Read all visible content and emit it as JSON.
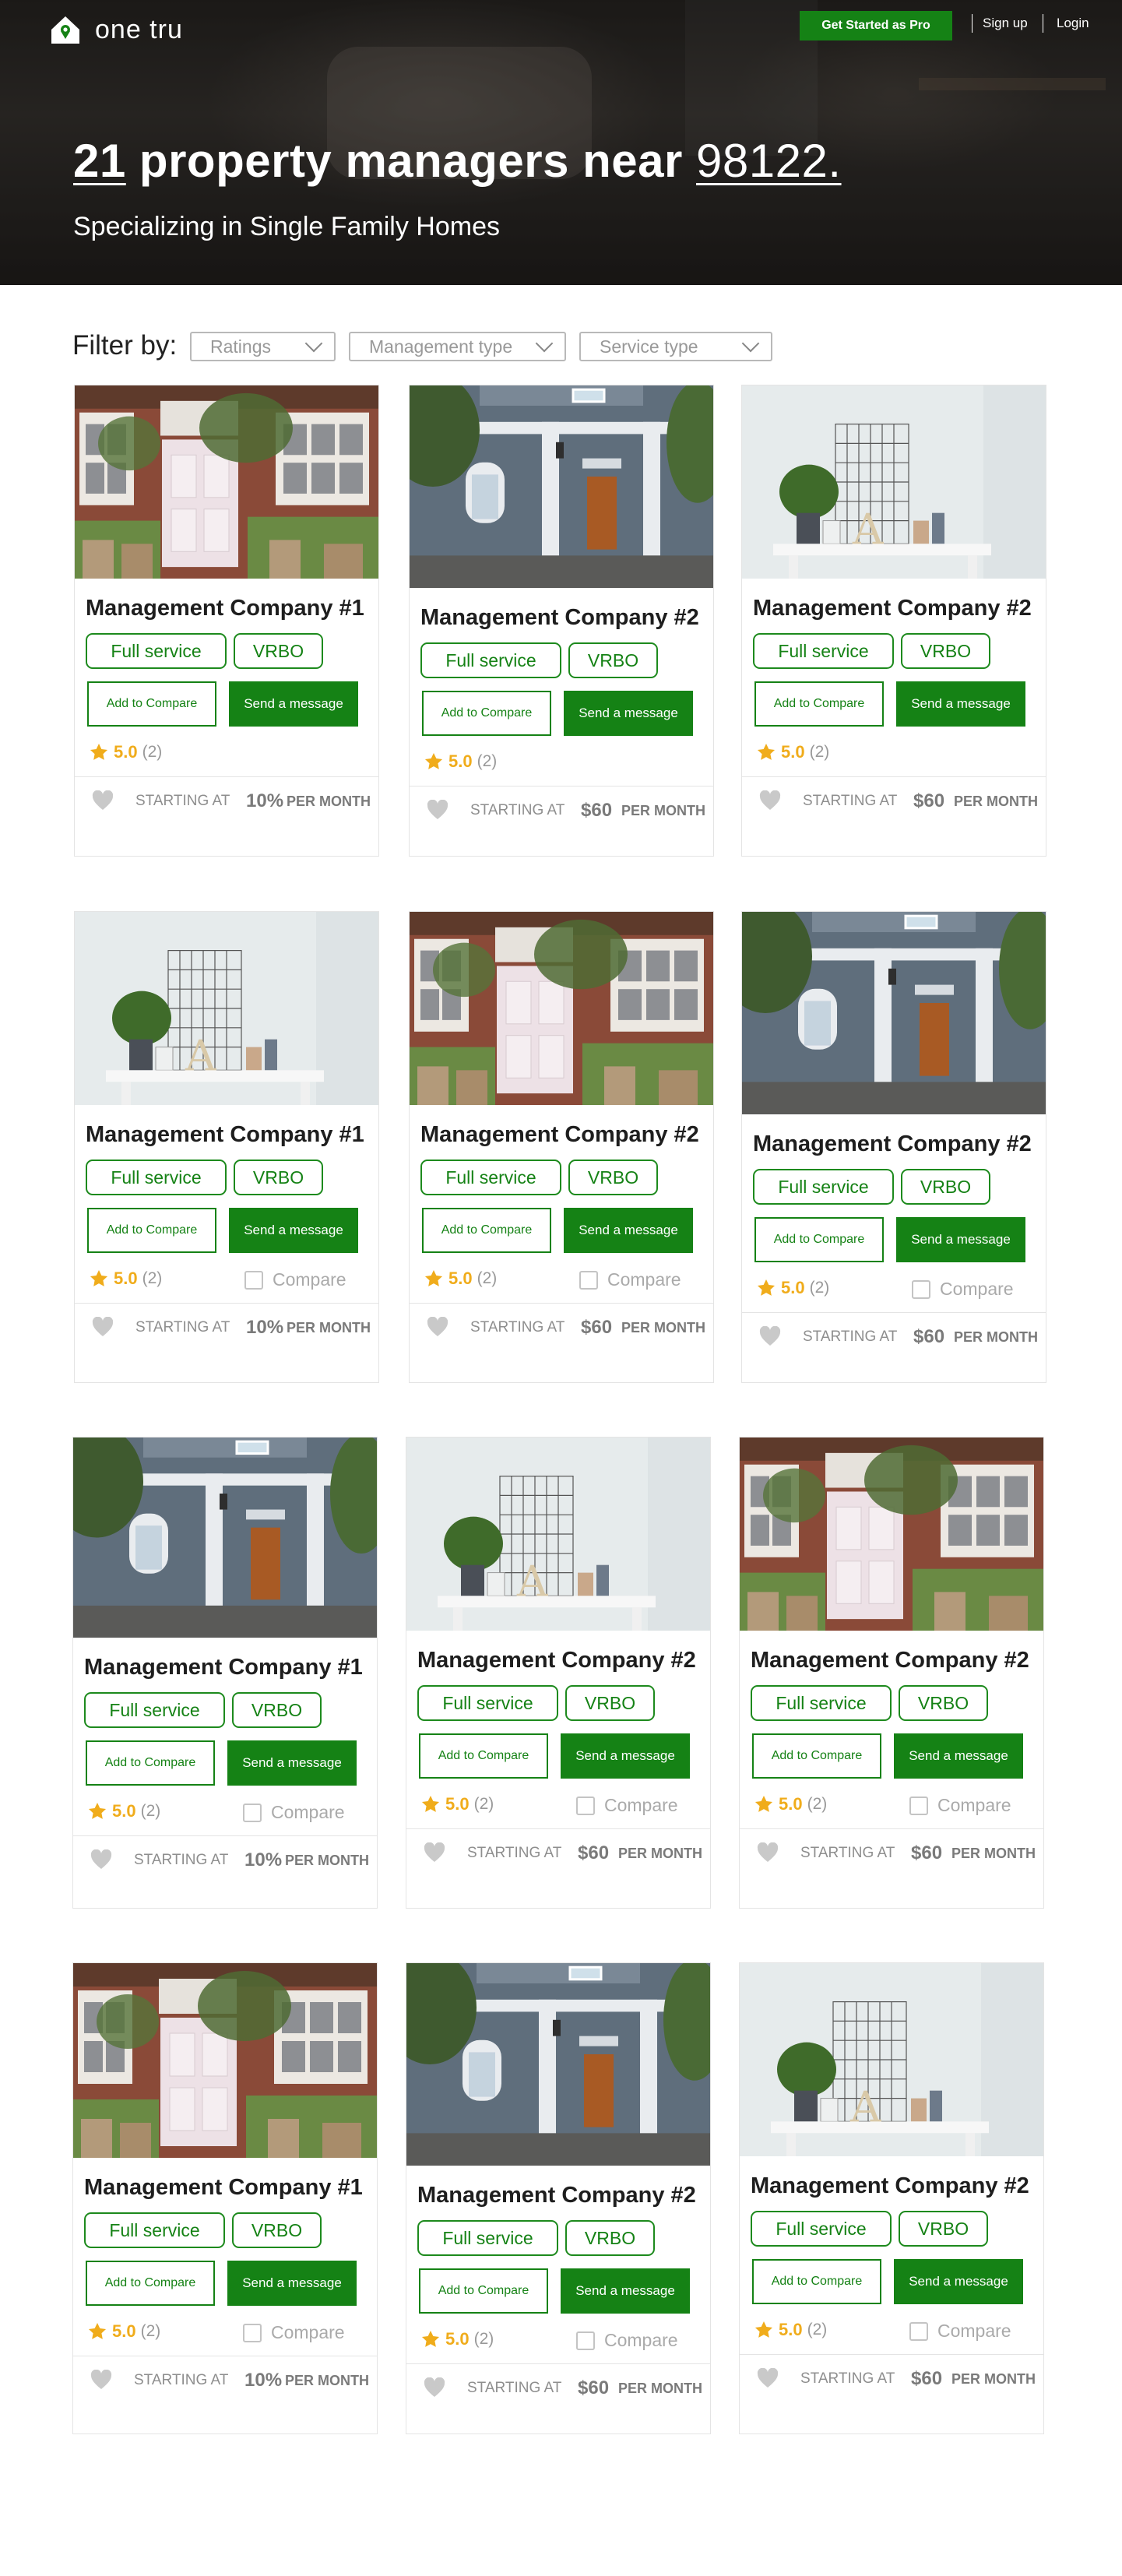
{
  "brand": {
    "name": "one tru",
    "accent": "#158215",
    "star": "#f0ac1b"
  },
  "nav": {
    "pro_button": "Get Started as Pro",
    "signup": "Sign up",
    "login": "Login"
  },
  "hero": {
    "count": "21",
    "mid_text": " property managers near ",
    "zip": "98122.",
    "subtitle": "Specializing in Single Family Homes"
  },
  "filters": {
    "label": "Filter by:",
    "items": [
      "Ratings",
      "Management type",
      "Service type"
    ]
  },
  "labels": {
    "add_compare": "Add to Compare",
    "send_message": "Send a message",
    "compare": "Compare",
    "starting_at": "STARTING AT",
    "per_month": "PER MONTH"
  },
  "cards": [
    {
      "image": "brick-door-image",
      "title": "Management Company #1",
      "tags": [
        "Full service",
        "VRBO"
      ],
      "rating": "5.0",
      "reviews": "(2)",
      "price": "10%",
      "has_compare": false
    },
    {
      "image": "blue-house-image",
      "title": "Management Company #2",
      "tags": [
        "Full service",
        "VRBO"
      ],
      "rating": "5.0",
      "reviews": "(2)",
      "price": "$60",
      "has_compare": false
    },
    {
      "image": "plant-shelf-image",
      "title": "Management Company #2",
      "tags": [
        "Full service",
        "VRBO"
      ],
      "rating": "5.0",
      "reviews": "(2)",
      "price": "$60",
      "has_compare": false
    },
    {
      "image": "plant-shelf-image",
      "title": "Management Company #1",
      "tags": [
        "Full service",
        "VRBO"
      ],
      "rating": "5.0",
      "reviews": "(2)",
      "price": "10%",
      "has_compare": true
    },
    {
      "image": "brick-door-image",
      "title": "Management Company #2",
      "tags": [
        "Full service",
        "VRBO"
      ],
      "rating": "5.0",
      "reviews": "(2)",
      "price": "$60",
      "has_compare": true
    },
    {
      "image": "blue-house-image",
      "title": "Management Company #2",
      "tags": [
        "Full service",
        "VRBO"
      ],
      "rating": "5.0",
      "reviews": "(2)",
      "price": "$60",
      "has_compare": true
    },
    {
      "image": "blue-house-image",
      "title": "Management Company #1",
      "tags": [
        "Full service",
        "VRBO"
      ],
      "rating": "5.0",
      "reviews": "(2)",
      "price": "10%",
      "has_compare": true
    },
    {
      "image": "plant-shelf-image",
      "title": "Management Company #2",
      "tags": [
        "Full service",
        "VRBO"
      ],
      "rating": "5.0",
      "reviews": "(2)",
      "price": "$60",
      "has_compare": true
    },
    {
      "image": "brick-door-image",
      "title": "Management Company #2",
      "tags": [
        "Full service",
        "VRBO"
      ],
      "rating": "5.0",
      "reviews": "(2)",
      "price": "$60",
      "has_compare": true
    },
    {
      "image": "brick-door-image",
      "title": "Management Company #1",
      "tags": [
        "Full service",
        "VRBO"
      ],
      "rating": "5.0",
      "reviews": "(2)",
      "price": "10%",
      "has_compare": true
    },
    {
      "image": "blue-house-image",
      "title": "Management Company #2",
      "tags": [
        "Full service",
        "VRBO"
      ],
      "rating": "5.0",
      "reviews": "(2)",
      "price": "$60",
      "has_compare": true
    },
    {
      "image": "plant-shelf-image",
      "title": "Management Company #2",
      "tags": [
        "Full service",
        "VRBO"
      ],
      "rating": "5.0",
      "reviews": "(2)",
      "price": "$60",
      "has_compare": true
    }
  ]
}
